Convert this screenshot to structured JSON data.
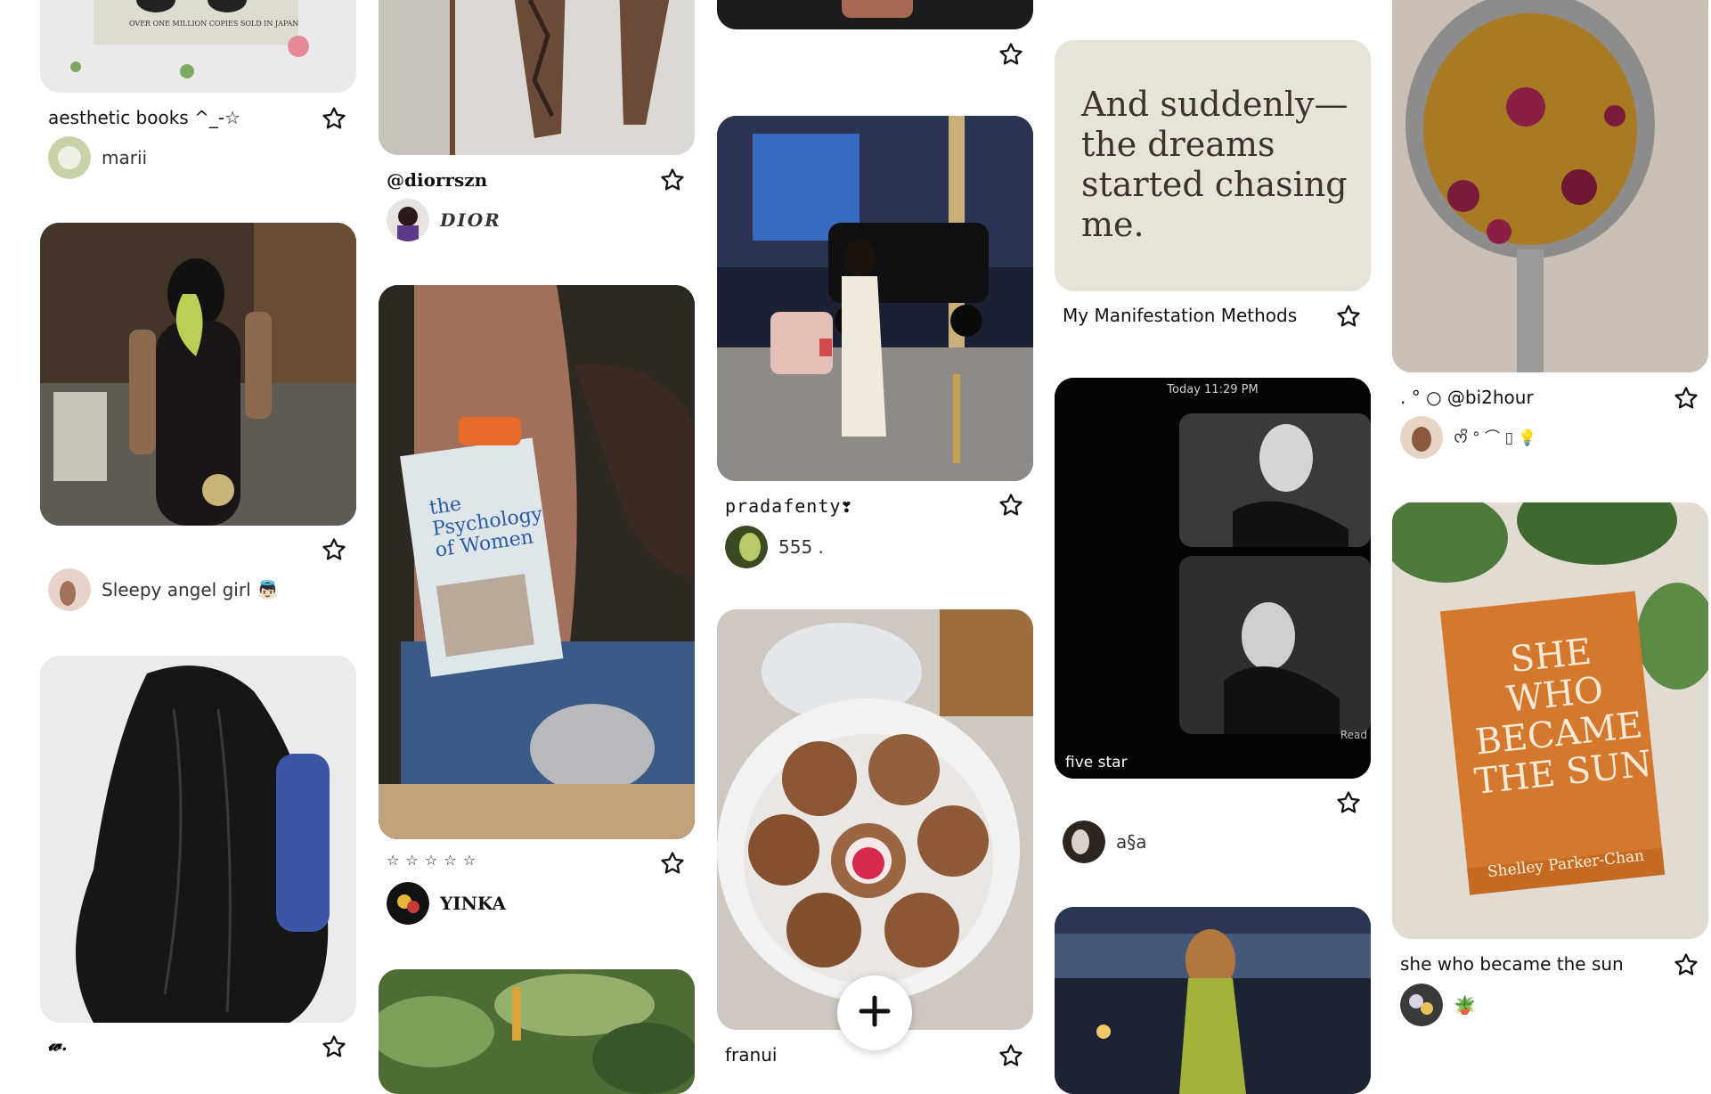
{
  "pins": {
    "c1p1": {
      "title": "aesthetic books ^_-☆",
      "owner": "marii",
      "image_text": "OVER ONE MILLION COPIES SOLD IN JAPAN"
    },
    "c1p2": {
      "owner": "Sleepy angel girl 👼🏻"
    },
    "c1p3": {
      "title": "𝔀."
    },
    "c2p1": {
      "title": "@diorrszn",
      "owner": "DIOR"
    },
    "c2p2": {
      "title": "☆ ☆ ☆ ☆ ☆",
      "owner": "YINKA",
      "image_text": "the Psychology of Women"
    },
    "c3p2": {
      "title": "pradafenty❣",
      "owner": "555 ."
    },
    "c3p3": {
      "title": "franui"
    },
    "c4p1": {
      "title": "My Manifestation Methods",
      "quote": "And suddenly— the dreams started chasing me."
    },
    "c4p2": {
      "owner": "a§a",
      "badge": "five star",
      "time": "Today 11:29 PM",
      "read": "Read"
    },
    "c5p1": {
      "title": ". ° ○ @bi2hour",
      "owner": "ᰔᩚ ° ⌒ ▯ 💡"
    },
    "c5p2": {
      "title": "she who became the sun",
      "owner": "🪴",
      "book_title": "SHE WHO BECAME THE SUN",
      "book_author": "Shelley Parker-Chan"
    }
  },
  "fab_icon": "plus-icon",
  "colors": {
    "background": "#ffffff",
    "text": "#111111",
    "star_outline": "#111111"
  }
}
